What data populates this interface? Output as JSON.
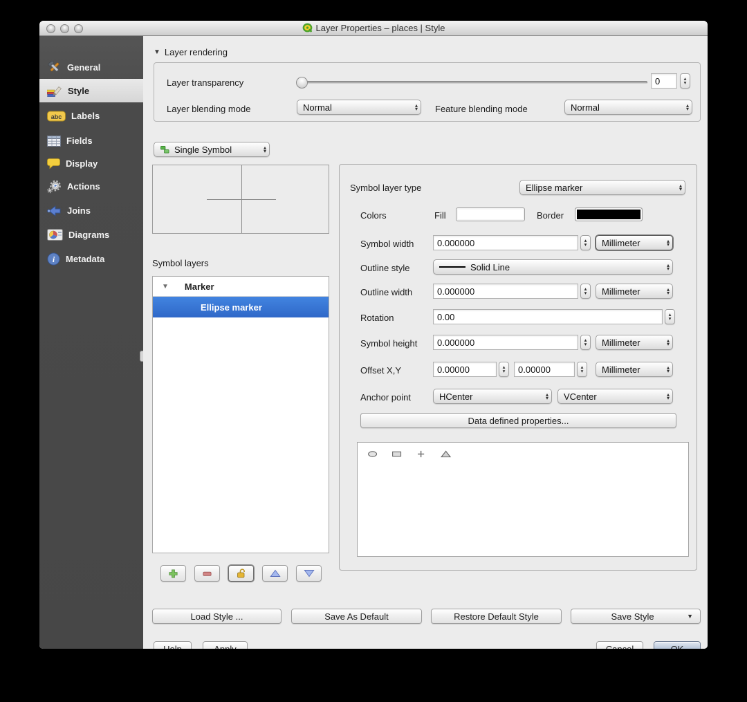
{
  "window": {
    "title": "Layer Properties – places | Style"
  },
  "sidebar": {
    "items": [
      {
        "label": "General",
        "icon": "tools-icon"
      },
      {
        "label": "Style",
        "icon": "paintbrush-icon"
      },
      {
        "label": "Labels",
        "icon": "abc-icon"
      },
      {
        "label": "Fields",
        "icon": "table-icon"
      },
      {
        "label": "Display",
        "icon": "speech-bubble-icon"
      },
      {
        "label": "Actions",
        "icon": "gear-icon"
      },
      {
        "label": "Joins",
        "icon": "join-arrow-icon"
      },
      {
        "label": "Diagrams",
        "icon": "chart-icon"
      },
      {
        "label": "Metadata",
        "icon": "info-icon"
      }
    ],
    "selected": "Style"
  },
  "rendering": {
    "section_title": "Layer rendering",
    "transparency_label": "Layer transparency",
    "transparency_value": "0",
    "layer_blend_label": "Layer blending mode",
    "layer_blend_value": "Normal",
    "feature_blend_label": "Feature blending mode",
    "feature_blend_value": "Normal"
  },
  "symbol_panel": {
    "renderer_value": "Single Symbol",
    "symbol_layers_label": "Symbol layers",
    "tree_group_label": "Marker",
    "tree_selected_label": "Ellipse marker",
    "layer_buttons": [
      "add-layer",
      "remove-layer",
      "lock-layer",
      "move-up",
      "move-down"
    ]
  },
  "props": {
    "type_label": "Symbol layer type",
    "type_value": "Ellipse marker",
    "colors_label": "Colors",
    "fill_label": "Fill",
    "border_label": "Border",
    "width_label": "Symbol width",
    "width_value": "0.000000",
    "outline_style_label": "Outline style",
    "outline_style_value": "Solid Line",
    "outline_width_label": "Outline width",
    "outline_width_value": "0.000000",
    "rotation_label": "Rotation",
    "rotation_value": "0.00",
    "height_label": "Symbol height",
    "height_value": "0.000000",
    "offset_label": "Offset X,Y",
    "offset_x_value": "0.00000",
    "offset_y_value": "0.00000",
    "anchor_label": "Anchor point",
    "anchor_h_value": "HCenter",
    "anchor_v_value": "VCenter",
    "unit_millimeter": "Millimeter",
    "data_defined_label": "Data defined properties...",
    "shape_names": [
      "ellipse",
      "rectangle",
      "cross",
      "triangle"
    ]
  },
  "style_actions": {
    "load": "Load Style ...",
    "save_default": "Save As Default",
    "restore_default": "Restore Default Style",
    "save_style": "Save Style"
  },
  "footer": {
    "help": "Help",
    "apply": "Apply",
    "cancel": "Cancel",
    "ok": "OK"
  },
  "colors": {
    "fill_swatch": "#ffffff",
    "border_swatch": "#000000",
    "selection_blue": "#3875d6",
    "sidebar_bg": "#4a4a4a"
  }
}
